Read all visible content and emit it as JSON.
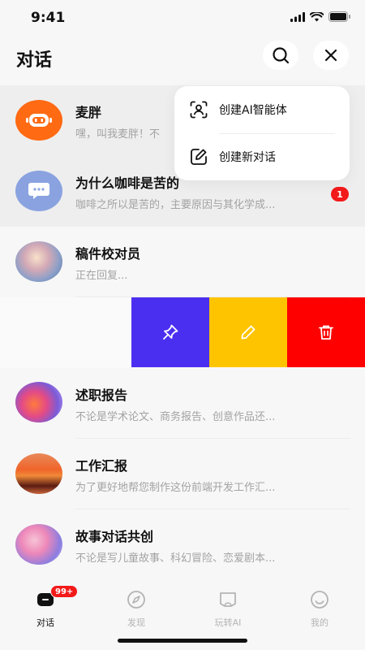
{
  "status_bar": {
    "time": "9:41"
  },
  "header": {
    "title": "对话"
  },
  "popup_menu": {
    "items": [
      {
        "label": "创建AI智能体",
        "icon": "user-scan-icon"
      },
      {
        "label": "创建新对话",
        "icon": "edit-chat-icon"
      }
    ]
  },
  "conversations": [
    {
      "title": "麦胖",
      "preview": "嘿，叫我麦胖！不",
      "avatar": "robot-avatar"
    },
    {
      "title": "为什么咖啡是苦的",
      "preview": "咖啡之所以是苦的，主要原因与其化学成...",
      "unread": "1",
      "avatar": "chat-bubble-avatar"
    },
    {
      "title": "稿件校对员",
      "preview": "正在回复...",
      "avatar": "gradient-avatar"
    },
    {
      "title": "述职报告",
      "preview": "不论是学术论文、商务报告、创意作品还...",
      "avatar": "gradient-avatar"
    },
    {
      "title": "工作汇报",
      "preview": "为了更好地帮您制作这份前端开发工作汇...",
      "avatar": "sunset-avatar"
    },
    {
      "title": "故事对话共创",
      "preview": "不论是写儿童故事、科幻冒险、恋爱剧本...",
      "avatar": "gradient-avatar"
    }
  ],
  "swipe_actions": [
    {
      "name": "pin",
      "color": "#4b2ff0"
    },
    {
      "name": "edit",
      "color": "#ffc400"
    },
    {
      "name": "delete",
      "color": "#fe0000"
    }
  ],
  "tabbar": {
    "tabs": [
      {
        "label": "对话",
        "badge": "99+",
        "active": true
      },
      {
        "label": "发现"
      },
      {
        "label": "玩转AI"
      },
      {
        "label": "我的"
      }
    ]
  },
  "colors": {
    "accent_red": "#f31a1a",
    "robot_orange": "#ff6a13"
  }
}
